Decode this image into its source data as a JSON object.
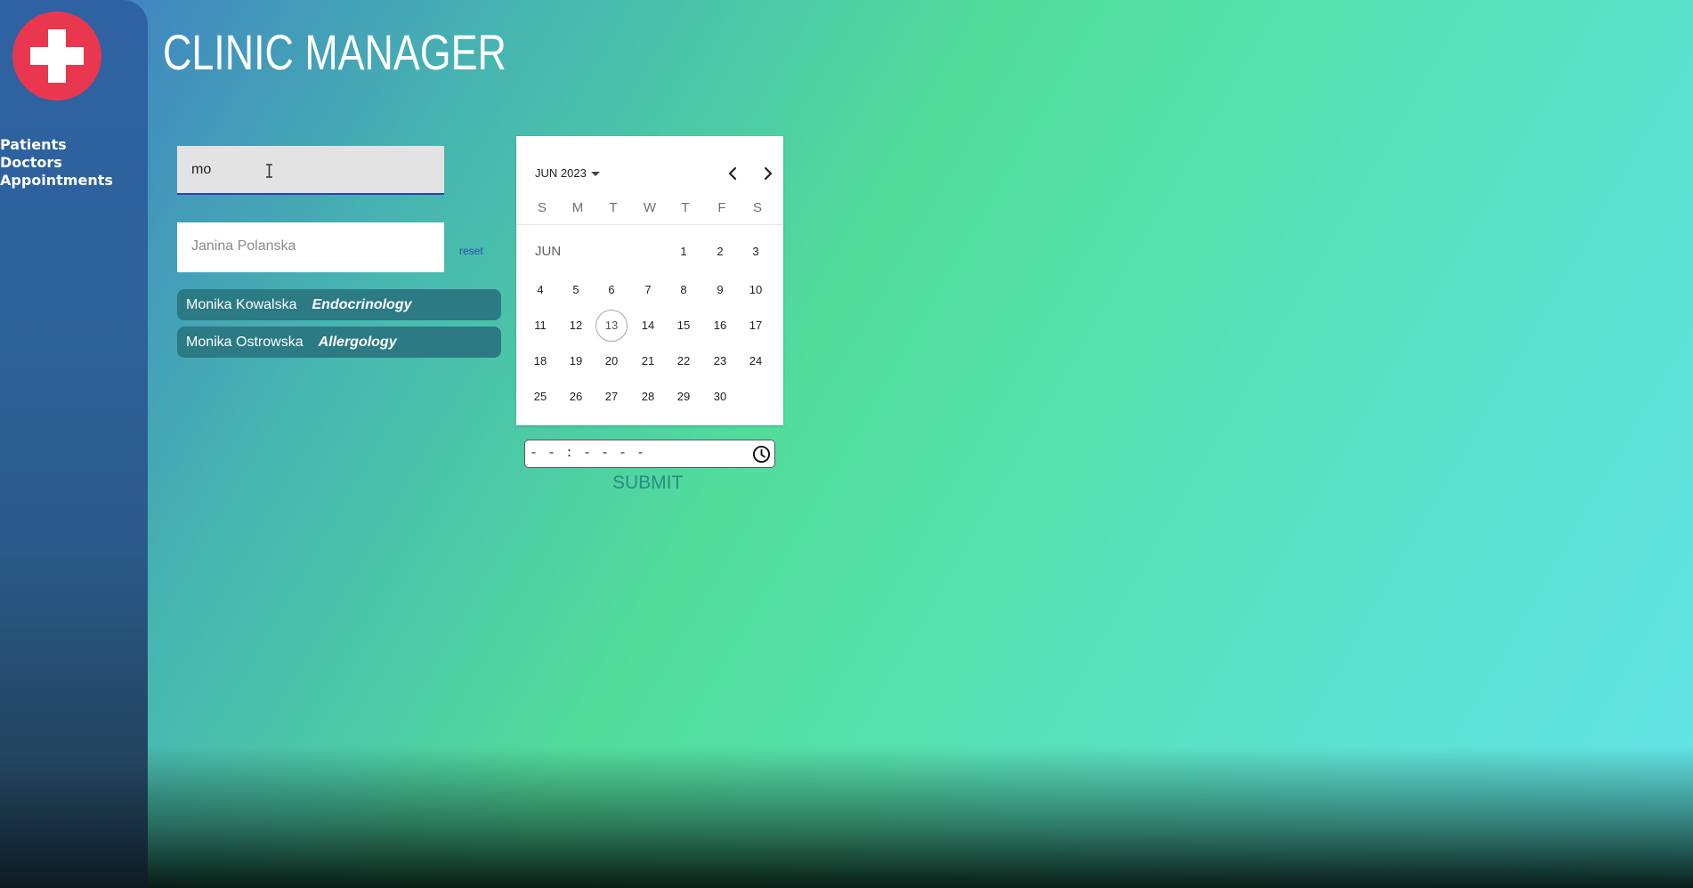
{
  "app": {
    "title": "CLINIC MANAGER",
    "logo_icon": "medical-cross-icon",
    "colors": {
      "logo": "#e9374f",
      "sidebar": "#2d629a",
      "doctor_item": "#2b7a84",
      "accent": "#2c3cc4"
    }
  },
  "sidebar": {
    "items": [
      {
        "label": "Patients"
      },
      {
        "label": "Doctors"
      },
      {
        "label": "Appointments"
      }
    ]
  },
  "search": {
    "value": "mo"
  },
  "patient": {
    "selected_name": "Janina Polanska",
    "reset_label": "reset"
  },
  "doctors": [
    {
      "name": "Monika Kowalska",
      "specialty": "Endocrinology"
    },
    {
      "name": "Monika Ostrowska",
      "specialty": "Allergology"
    }
  ],
  "calendar": {
    "header_label": "JUN 2023",
    "month_label": "JUN",
    "weekdays": [
      "S",
      "M",
      "T",
      "W",
      "T",
      "F",
      "S"
    ],
    "first_weekday_index": 4,
    "days_in_month": 30,
    "today": 13,
    "prev_icon": "chevron-left-icon",
    "next_icon": "chevron-right-icon"
  },
  "time": {
    "placeholder": "- - : - -   - -",
    "icon": "clock-icon"
  },
  "submit": {
    "label": "SUBMIT"
  }
}
